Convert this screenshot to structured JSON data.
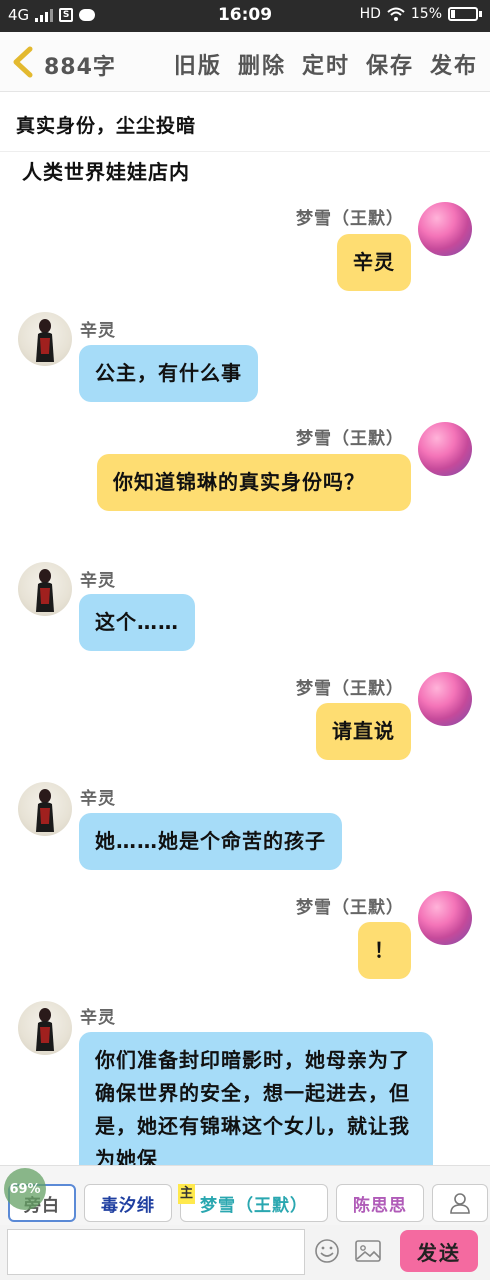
{
  "status_bar": {
    "network": "4G",
    "time": "16:09",
    "hd": "HD",
    "battery": "15%"
  },
  "toolbar": {
    "word_count": "884字",
    "actions": [
      "旧版",
      "删除",
      "定时",
      "保存",
      "发布"
    ]
  },
  "chapter_title": "真实身份，尘尘投暗",
  "scene": "人类世界娃娃店内",
  "messages": [
    {
      "side": "right",
      "name": "梦雪（王默）",
      "text": "辛灵"
    },
    {
      "side": "left",
      "name": "辛灵",
      "text": "公主，有什么事"
    },
    {
      "side": "right",
      "name": "梦雪（王默）",
      "text": "你知道锦琳的真实身份吗？"
    },
    {
      "side": "left",
      "name": "辛灵",
      "text": "这个……"
    },
    {
      "side": "right",
      "name": "梦雪（王默）",
      "text": "请直说"
    },
    {
      "side": "left",
      "name": "辛灵",
      "text": "她……她是个命苦的孩子"
    },
    {
      "side": "right",
      "name": "梦雪（王默）",
      "text": "！"
    },
    {
      "side": "left",
      "name": "辛灵",
      "text": "你们准备封印暗影时，她母亲为了确保世界的安全，想一起进去，但是，她还有锦琳这个女儿，就让我为她保"
    }
  ],
  "roles": {
    "items": [
      "旁白",
      "毒汐绯",
      "梦雪（王默）",
      "陈思思"
    ],
    "main_tag": "主",
    "progress": "69%"
  },
  "input": {
    "value": "",
    "placeholder": "",
    "send_label": "发送"
  },
  "colors": {
    "right_bubble": "#fedd72",
    "left_bubble": "#a6dcf8",
    "send_button": "#f46aa0"
  }
}
